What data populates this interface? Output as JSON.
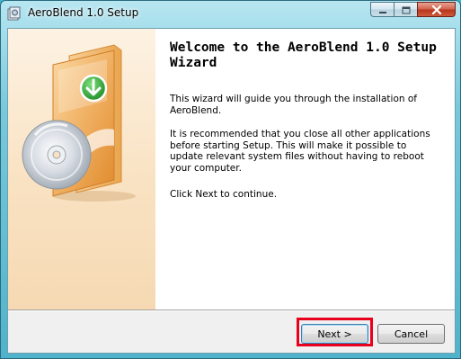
{
  "window": {
    "title": "AeroBlend 1.0 Setup"
  },
  "content": {
    "heading": "Welcome to the AeroBlend 1.0 Setup Wizard",
    "paragraph_1": "This wizard will guide you through the installation of AeroBlend.",
    "paragraph_2": "It is recommended that you close all other applications before starting Setup. This will make it possible to update relevant system files without having to reboot your computer.",
    "paragraph_3": "Click Next to continue."
  },
  "buttons": {
    "next_label": "Next >",
    "cancel_label": "Cancel"
  },
  "icons": {
    "app": "installer-icon",
    "minimize": "minimize-icon",
    "maximize": "maximize-icon",
    "close": "close-icon",
    "hero": "software-box-with-disc-icon"
  },
  "colors": {
    "highlight": "#e8001c",
    "close_button": "#c2452a",
    "sidebar": "#f9e2c2"
  }
}
